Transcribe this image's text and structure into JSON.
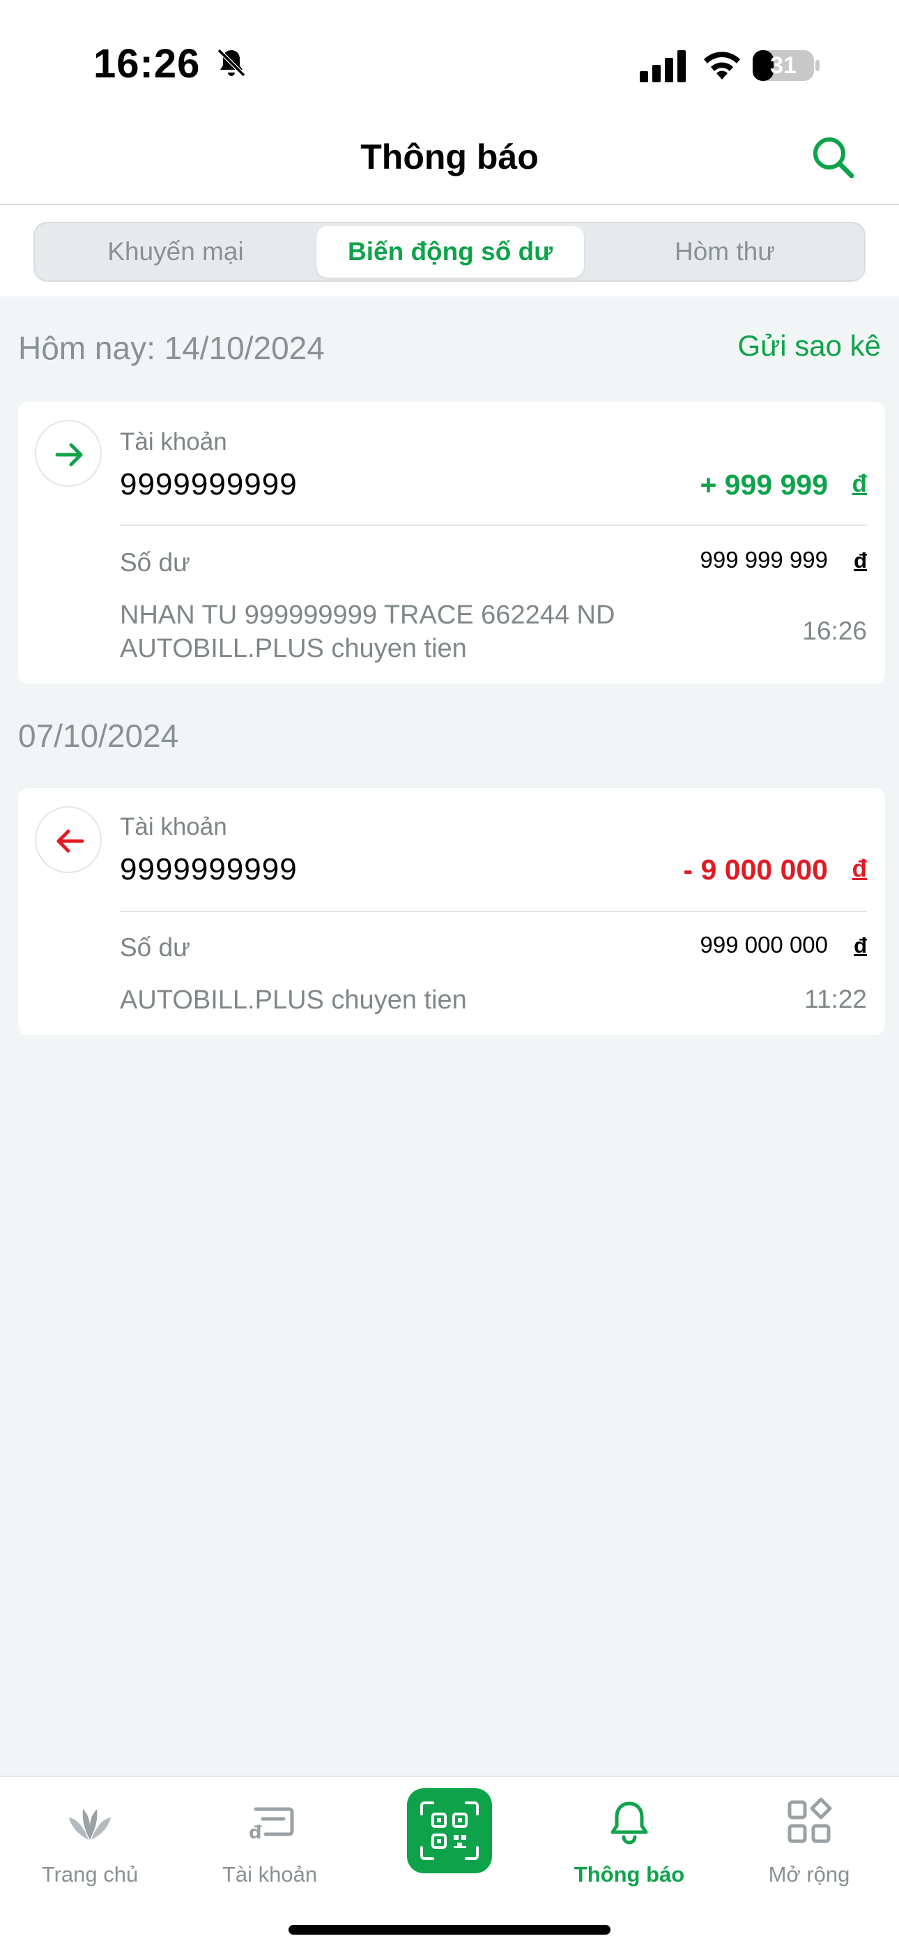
{
  "status_bar": {
    "time": "16:26",
    "battery": "31"
  },
  "header": {
    "title": "Thông báo"
  },
  "tabs": [
    {
      "label": "Khuyến mại",
      "active": false
    },
    {
      "label": "Biến động số dư",
      "active": true
    },
    {
      "label": "Hòm thư",
      "active": false
    }
  ],
  "statement_link": "Gửi sao kê",
  "sections": [
    {
      "date": "Hôm nay: 14/10/2024",
      "transaction": {
        "direction": "in",
        "account_label": "Tài khoản",
        "account": "9999999999",
        "amount": "+ 999 999",
        "currency": "đ",
        "balance_label": "Số dư",
        "balance": "999 999 999",
        "description_line1": "NHAN TU 999999999 TRACE 662244 ND",
        "description_line2": "AUTOBILL.PLUS chuyen tien",
        "time": "16:26"
      }
    },
    {
      "date": "07/10/2024",
      "transaction": {
        "direction": "out",
        "account_label": "Tài khoản",
        "account": "9999999999",
        "amount": "- 9 000 000",
        "currency": "đ",
        "balance_label": "Số dư",
        "balance": "999 000 000",
        "description_line1": "AUTOBILL.PLUS chuyen tien",
        "time": "11:22"
      }
    }
  ],
  "bottom_nav": [
    {
      "label": "Trang chủ",
      "icon": "home-logo-icon",
      "active": false
    },
    {
      "label": "Tài khoản",
      "icon": "account-card-icon",
      "active": false
    },
    {
      "label": "",
      "icon": "qr-code-icon",
      "active": false
    },
    {
      "label": "Thông báo",
      "icon": "bell-icon",
      "active": true
    },
    {
      "label": "Mở rộng",
      "icon": "apps-grid-icon",
      "active": false
    }
  ],
  "colors": {
    "accent": "#0ea34a",
    "negative": "#e01b24",
    "background": "#f2f5f6"
  }
}
